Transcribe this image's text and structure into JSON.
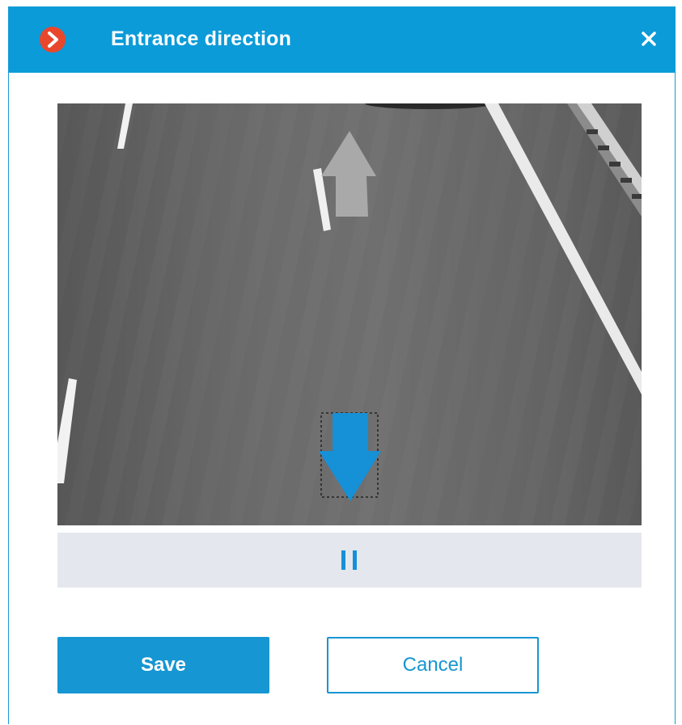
{
  "dialog": {
    "title": "Entrance direction",
    "app_icon": "chevron-right-icon",
    "close_icon": "close-icon"
  },
  "video": {
    "content": "road-camera-frame",
    "direction_arrow_icon": "arrow-down-icon",
    "road_marking_icon": "arrow-up-icon"
  },
  "player": {
    "pause_icon": "pause-icon"
  },
  "buttons": {
    "save_label": "Save",
    "cancel_label": "Cancel"
  },
  "colors": {
    "accent": "#0b9bd8",
    "logo": "#e8472b",
    "arrow": "#1690d6"
  }
}
